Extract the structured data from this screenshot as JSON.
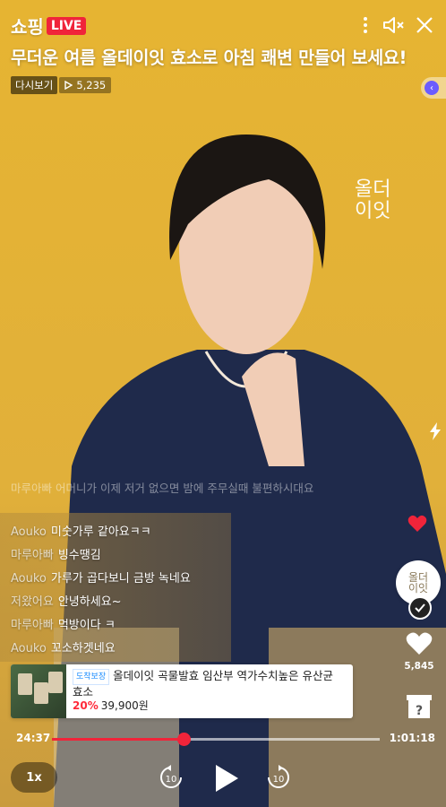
{
  "brand": {
    "name": "쇼핑",
    "live": "LIVE"
  },
  "title": "무더운 여름 올데이잇 효소로 아침 쾌변 만들어 보세요!",
  "meta": {
    "replay_label": "다시보기",
    "view_count": "5,235"
  },
  "watermark": [
    "올더",
    "이잇"
  ],
  "faded_comment": "마루아빠 어머니가 이제 저거 없으면 밤에 주무실때 불편하시대요",
  "chat": [
    {
      "user": "Aouko",
      "message": "미숫가루 같아요ㅋㅋ"
    },
    {
      "user": "마루아빠",
      "message": "빙수땡김"
    },
    {
      "user": "Aouko",
      "message": "가루가 곱다보니 금방 녹네요"
    },
    {
      "user": "저왔어요",
      "message": "안녕하세요~"
    },
    {
      "user": "마루아빠",
      "message": "먹방이다 ㅋ"
    },
    {
      "user": "Aouko",
      "message": "꼬소하겟네요"
    }
  ],
  "like_count": "5,845",
  "product": {
    "badge": "도착보장",
    "name": "올데이잇 곡물발효 임산부 역가수치높은 유산균 효소",
    "discount": "20%",
    "price": "39,900원"
  },
  "player": {
    "current_time": "24:37",
    "total_time": "1:01:18",
    "progress": 0.401,
    "speed": "1x",
    "rewind_seconds": "10",
    "forward_seconds": "10"
  },
  "colors": {
    "accent": "#f0243a",
    "background": "#e5b638"
  },
  "icons": [
    "more-icon",
    "mute-icon",
    "close-icon",
    "play-triangle-icon",
    "flash-icon",
    "heart-icon",
    "check-icon",
    "gift-box-icon",
    "rewind-10-icon",
    "play-icon",
    "forward-10-icon"
  ]
}
